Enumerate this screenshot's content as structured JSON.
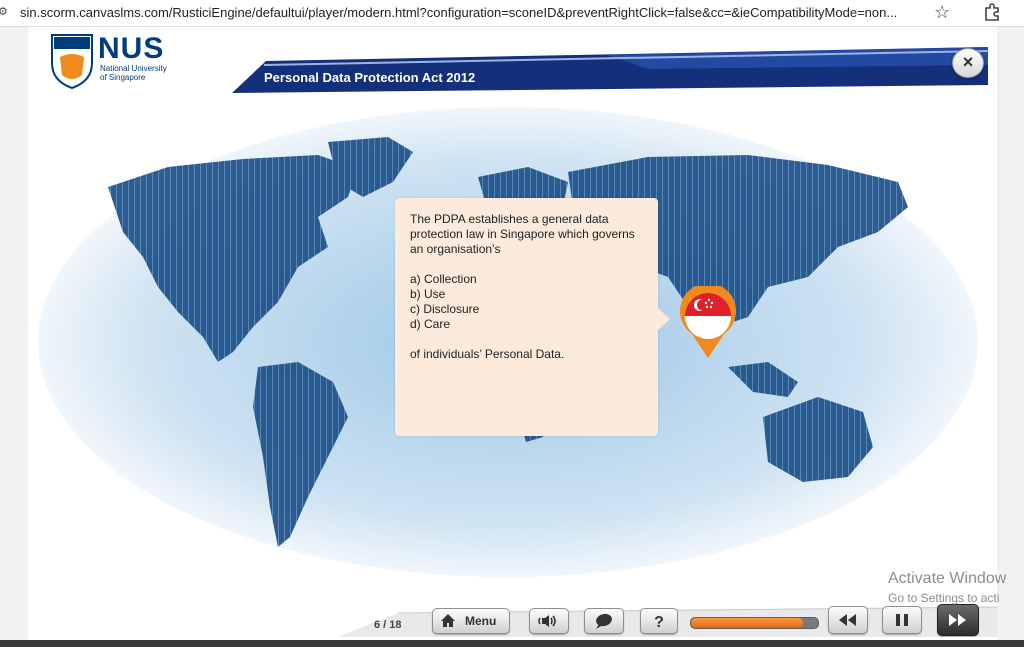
{
  "browser": {
    "url": "sin.scorm.canvaslms.com/RusticiEngine/defaultui/player/modern.html?configuration=sconeID&preventRightClick=false&cc=&ieCompatibilityMode=non...",
    "site_settings_icon": "tune-icon",
    "bookmark_icon": "star-icon",
    "extensions_icon": "puzzle-icon"
  },
  "header": {
    "logo_text": "NUS",
    "logo_subtitle_line1": "National University",
    "logo_subtitle_line2": "of Singapore",
    "title": "Personal Data Protection Act 2012",
    "close_label": "×",
    "band_color": "#1a3a8c"
  },
  "slide": {
    "card": {
      "intro": "The PDPA establishes a general data protection law in Singapore which governs an organisation’s",
      "options": [
        "a) Collection",
        "b) Use",
        "c) Disclosure",
        "d) Care"
      ],
      "closing": "of individuals’ Personal Data."
    },
    "pin_icon": "singapore-flag-pin-icon",
    "card_color": "#fcebdd",
    "pin_color": "#f08a1c"
  },
  "controls": {
    "page_counter": "6 / 18",
    "menu_label": "Menu",
    "progress": 0.88,
    "progress_color": "#f07a20"
  },
  "watermark": {
    "line1": "Activate Window",
    "line2": "Go to Settings to acti"
  }
}
